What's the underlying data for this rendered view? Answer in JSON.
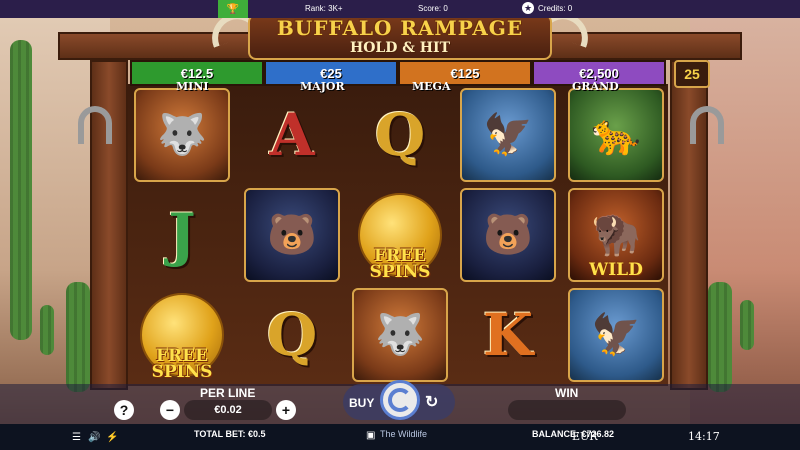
{
  "topbar": {
    "rank": "Rank: 3K+",
    "score": "Score: 0",
    "credits": "Credits: 0"
  },
  "title": {
    "main": "BUFFALO RAMPAGE",
    "sub": "HOLD & HIT"
  },
  "jackpots": [
    {
      "value": "€12.5",
      "label": "MINI",
      "color": "#2e9a2e"
    },
    {
      "value": "€25",
      "label": "MAJOR",
      "color": "#2f6fc9"
    },
    {
      "value": "€125",
      "label": "MEGA",
      "color": "#d2731f"
    },
    {
      "value": "€2,500",
      "label": "GRAND",
      "color": "#8e4bc0"
    }
  ],
  "lines": "25",
  "reels": [
    [
      {
        "kind": "animal",
        "name": "wolf"
      },
      {
        "kind": "letter",
        "text": "J",
        "color": "#3aa24a"
      },
      {
        "kind": "coin",
        "overtext": "FREE SPINS"
      }
    ],
    [
      {
        "kind": "letter",
        "text": "A",
        "color": "#c0302a"
      },
      {
        "kind": "animal",
        "name": "bear"
      },
      {
        "kind": "letter",
        "text": "Q",
        "color": "#d9a42a"
      }
    ],
    [
      {
        "kind": "letter",
        "text": "Q",
        "color": "#d9a42a"
      },
      {
        "kind": "coin",
        "overtext": "FREE SPINS"
      },
      {
        "kind": "animal",
        "name": "wolf"
      }
    ],
    [
      {
        "kind": "animal",
        "name": "eagle"
      },
      {
        "kind": "animal",
        "name": "bear"
      },
      {
        "kind": "letter",
        "text": "K",
        "color": "#e07020"
      }
    ],
    [
      {
        "kind": "animal",
        "name": "cougar"
      },
      {
        "kind": "animal",
        "name": "buffalo",
        "overtext": "WILD"
      },
      {
        "kind": "animal",
        "name": "eagle"
      }
    ]
  ],
  "controls": {
    "per_line_label": "PER LINE",
    "per_line_value": "€0.02",
    "minus": "−",
    "plus": "+",
    "help": "?",
    "buy": "BUY",
    "win_label": "WIN",
    "autoplay_icon": "↻"
  },
  "footer": {
    "total_bet": "TOTAL BET: €0.5",
    "brand": "The Wildlife",
    "balance": "BALANCE: €726.82",
    "currency": "EUR",
    "time": "14:17"
  }
}
